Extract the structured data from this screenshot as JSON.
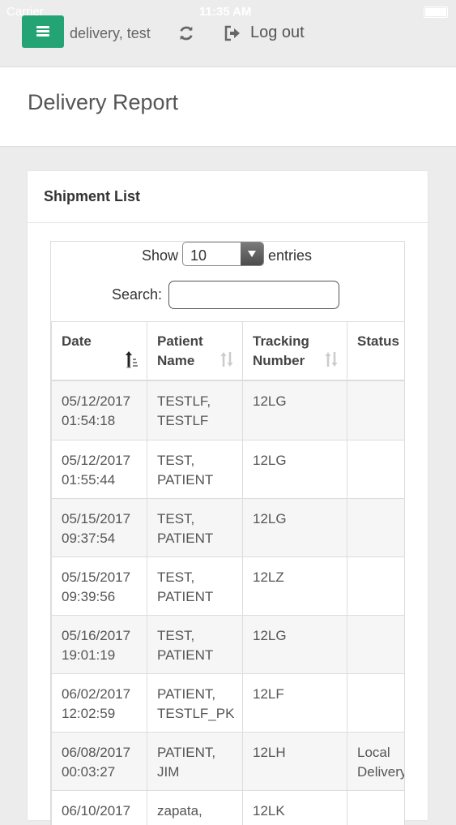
{
  "status_bar": {
    "carrier": "Carrier",
    "time": "11:35 AM"
  },
  "navbar": {
    "menu_icon": "hamburger-menu-icon",
    "user": "delivery, test",
    "refresh_icon": "refresh-icon",
    "logout_icon": "logout-icon",
    "logout_label": "Log out"
  },
  "page": {
    "title": "Delivery Report"
  },
  "panel": {
    "title": "Shipment List"
  },
  "table_controls": {
    "show_label": "Show",
    "length_value": "10",
    "entries_label": "entries",
    "search_label": "Search:",
    "search_value": ""
  },
  "table": {
    "columns": [
      {
        "line1": "Date",
        "line2": "",
        "sort": "sort-ascending-icon"
      },
      {
        "line1": "Patient",
        "line2": "Name",
        "sort": "sort-both-icon"
      },
      {
        "line1": "Tracking",
        "line2": "Number",
        "sort": "sort-both-icon"
      },
      {
        "line1": "Status",
        "line2": "",
        "sort": ""
      }
    ],
    "rows": [
      {
        "date1": "05/12/2017",
        "date2": "01:54:18",
        "name1": "TESTLF,",
        "name2": "TESTLF",
        "tracking": "12LG",
        "status1": "",
        "status2": ""
      },
      {
        "date1": "05/12/2017",
        "date2": "01:55:44",
        "name1": "TEST,",
        "name2": "PATIENT",
        "tracking": "12LG",
        "status1": "",
        "status2": ""
      },
      {
        "date1": "05/15/2017",
        "date2": "09:37:54",
        "name1": "TEST,",
        "name2": "PATIENT",
        "tracking": "12LG",
        "status1": "",
        "status2": ""
      },
      {
        "date1": "05/15/2017",
        "date2": "09:39:56",
        "name1": "TEST,",
        "name2": "PATIENT",
        "tracking": "12LZ",
        "status1": "",
        "status2": ""
      },
      {
        "date1": "05/16/2017",
        "date2": "19:01:19",
        "name1": "TEST,",
        "name2": "PATIENT",
        "tracking": "12LG",
        "status1": "",
        "status2": ""
      },
      {
        "date1": "06/02/2017",
        "date2": "12:02:59",
        "name1": "PATIENT,",
        "name2": "TESTLF_PK",
        "tracking": "12LF",
        "status1": "",
        "status2": ""
      },
      {
        "date1": "06/08/2017",
        "date2": "00:03:27",
        "name1": "PATIENT,",
        "name2": "JIM",
        "tracking": "12LH",
        "status1": "Local",
        "status2": "Delivery"
      },
      {
        "date1": "06/10/2017",
        "date2": "",
        "name1": "zapata,",
        "name2": "",
        "tracking": "12LK",
        "status1": "",
        "status2": ""
      }
    ]
  }
}
